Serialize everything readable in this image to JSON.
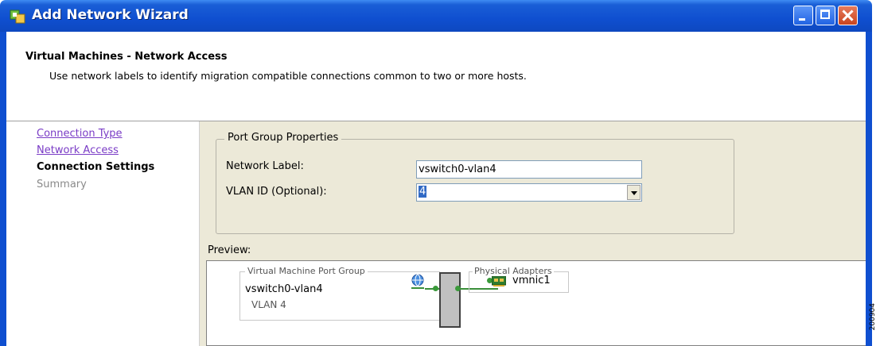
{
  "window": {
    "title": "Add Network Wizard",
    "icons": [
      "wizard-icon",
      "minimize-icon",
      "maximize-icon",
      "close-icon"
    ]
  },
  "header": {
    "title": "Virtual Machines - Network Access",
    "description": "Use network labels to identify migration compatible connections common to two or more hosts."
  },
  "sidebar": {
    "items": [
      {
        "label": "Connection Type",
        "state": "link"
      },
      {
        "label": "Network Access",
        "state": "link"
      },
      {
        "label": "Connection Settings",
        "state": "current"
      },
      {
        "label": "Summary",
        "state": "disabled"
      }
    ]
  },
  "port_group": {
    "legend": "Port Group Properties",
    "network_label_label": "Network Label:",
    "network_label_value": "vswitch0-vlan4",
    "vlan_label": "VLAN ID (Optional):",
    "vlan_value": "4"
  },
  "preview": {
    "label": "Preview:",
    "vm_group_legend": "Virtual Machine Port Group",
    "vm_group_name": "vswitch0-vlan4",
    "vm_group_vlan": "VLAN 4",
    "adapters_legend": "Physical Adapters",
    "adapter_name": "vmnic1"
  },
  "side_mark": "200904",
  "colors": {
    "titlebar": "#0f4fd0",
    "link": "#7a3cc6",
    "panel": "#ece9d8",
    "wire": "#3a8f3a"
  }
}
